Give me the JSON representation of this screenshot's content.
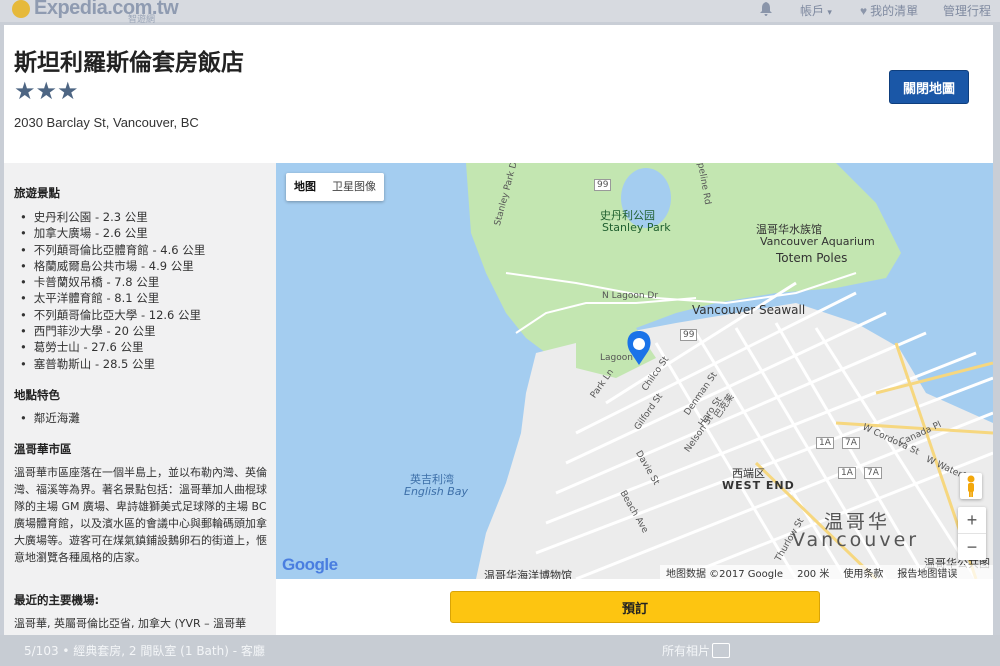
{
  "topbar": {
    "logo": "Expedia.com.tw",
    "logo_sub": "智遊網",
    "account_label": "帳戶",
    "account_arrow": "▾",
    "wishlist_label": "我的清單",
    "manage_trips_label": "管理行程"
  },
  "hotel": {
    "name": "斯坦利羅斯倫套房飯店",
    "stars": "★★★",
    "star_rating": 3,
    "address": "2030 Barclay St, Vancouver, BC",
    "close_map_label": "關閉地圖",
    "book_label": "預訂"
  },
  "sidebar": {
    "attractions_title": "旅遊景點",
    "attractions": [
      "史丹利公園 - 2.3 公里",
      "加拿大廣場 - 2.6 公里",
      "不列顛哥倫比亞體育館 - 4.6 公里",
      "格蘭威爾島公共市場 - 4.9 公里",
      "卡普蘭奴吊橋 - 7.8 公里",
      "太平洋體育館 - 8.1 公里",
      "不列顛哥倫比亞大學 - 12.6 公里",
      "西門菲沙大學 - 20 公里",
      "葛勞士山 - 27.6 公里",
      "塞普勒斯山 - 28.5 公里"
    ],
    "features_title": "地點特色",
    "features": [
      "鄰近海灘"
    ],
    "area_title": "溫哥華市區",
    "area_description": "溫哥華市區座落在一個半島上，並以布勒內灣、英倫灣、福溪等為界。著名景點包括：溫哥華加人曲棍球隊的主場 GM 廣場、卑詩雄獅美式足球隊的主場 BC 廣場體育館，以及濱水區的會議中心與郵輪碼頭加拿大廣場等。遊客可在煤氣鎮鋪設鵝卵石的街道上，愜意地瀏覽各種風格的店家。",
    "airport_title": "最近的主要機場:",
    "airport_text": "溫哥華, 英屬哥倫比亞省, 加拿大 (YVR – 溫哥華"
  },
  "map": {
    "type_map": "地图",
    "type_satellite": "卫星图像",
    "labels": {
      "stanley_park_cn": "史丹利公园",
      "stanley_park_en": "Stanley Park",
      "aquarium_cn": "温哥华水族馆",
      "aquarium_en": "Vancouver Aquarium",
      "totem_poles": "Totem Poles",
      "seawall": "Vancouver Seawall",
      "english_bay_cn": "英吉利湾",
      "english_bay_en": "English Bay",
      "west_end_cn": "西端区",
      "west_end_en": "WEST END",
      "vancouver_cn": "温哥华",
      "vancouver_en": "Vancouver",
      "maritime_museum": "温哥华海洋博物馆",
      "public_library": "温哥华公共图",
      "n_lagoon": "N Lagoon Dr",
      "lagoon": "Lagoon",
      "park_ln": "Park Ln",
      "chilco": "Chilco St",
      "gilford": "Gilford St",
      "denman": "Denman St",
      "haro": "Haro St",
      "barclay": "巴克莱",
      "nelson": "Nelson St",
      "davie": "Davie St",
      "beach_ave": "Beach Ave",
      "thurlow": "Thurlow St",
      "cordova": "W Cordova St",
      "canada_pl": "Canada Pl",
      "waterfront": "W Waterfro",
      "stanley_park_dr": "Stanley Park Dr",
      "pipeline": "Pipeline Rd",
      "hwy99_a": "99",
      "hwy99_b": "99",
      "hwy1a_a": "1A",
      "hwy7a_a": "7A",
      "hwy1a_b": "1A",
      "hwy7a_b": "7A"
    },
    "google": "Google",
    "footer_data": "地图数据 ©2017 Google",
    "footer_scale": "200 米",
    "footer_terms": "使用条款",
    "footer_report": "报告地图错误",
    "zoom_in": "+",
    "zoom_out": "−"
  },
  "bottom_strip": {
    "caption": "5/103 • 經典套房, 2 間臥室 (1 Bath) - 客廳",
    "all_photos": "所有相片"
  },
  "colors": {
    "close_button": "#1a57a7",
    "book_button": "#fdc511",
    "star": "#4d6583",
    "park_green": "#c3e6b1",
    "water": "#a4cdf0"
  }
}
